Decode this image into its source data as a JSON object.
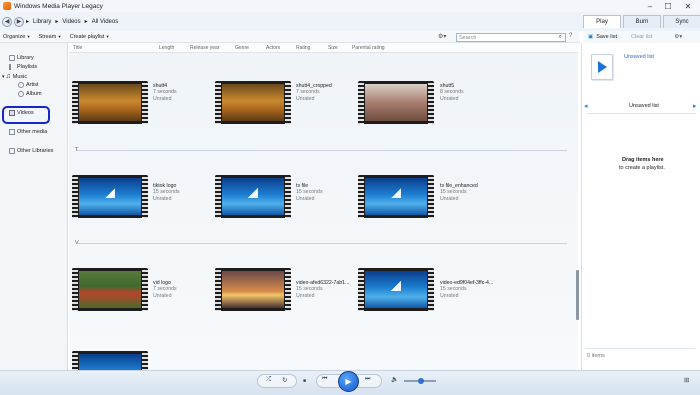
{
  "window": {
    "title": "Windows Media Player Legacy",
    "minimize": "–",
    "maximize": "☐",
    "close": "✕"
  },
  "nav": {
    "back_icon": "◀",
    "forward_icon": "▶",
    "breadcrumb": [
      "Library",
      "Videos",
      "All Videos"
    ],
    "sep": "▸"
  },
  "tabs": [
    {
      "label": "Play",
      "active": true
    },
    {
      "label": "Burn",
      "active": false
    },
    {
      "label": "Sync",
      "active": false
    }
  ],
  "toolbar": {
    "organize": "Organize",
    "stream": "Stream",
    "create_playlist": "Create playlist",
    "dropdown": "▾",
    "search_placeholder": "Search",
    "search_icon": "⌕"
  },
  "right_toolbar": {
    "save_list": "Save list",
    "clear_list": "Clear list"
  },
  "sidebar": {
    "items": [
      {
        "label": "Library"
      },
      {
        "label": "Playlists"
      },
      {
        "label": "Music"
      },
      {
        "label": "Artist"
      },
      {
        "label": "Album"
      },
      {
        "label": "Videos",
        "selected": true
      },
      {
        "label": "Other media"
      },
      {
        "label": "Other Libraries"
      }
    ]
  },
  "columns": [
    "Title",
    "Length",
    "Release year",
    "Genre",
    "Actors",
    "Rating",
    "Size",
    "Parental rating"
  ],
  "groups": [
    {
      "label": "",
      "items": [
        {
          "name": "shutt4",
          "duration": "7 seconds",
          "rating": "Unrated",
          "thumb": "golden"
        },
        {
          "name": "shutt4_cropped",
          "duration": "7 seconds",
          "rating": "Unrated",
          "thumb": "golden"
        },
        {
          "name": "shutt5",
          "duration": "8 seconds",
          "rating": "Unrated",
          "thumb": "room"
        }
      ]
    },
    {
      "label": "T",
      "items": [
        {
          "name": "tiktok logo",
          "duration": "15 seconds",
          "rating": "Unrated",
          "thumb": "ocean"
        },
        {
          "name": "ts file",
          "duration": "15 seconds",
          "rating": "Unrated",
          "thumb": "ocean"
        },
        {
          "name": "ts file_enhanced",
          "duration": "15 seconds",
          "rating": "Unrated",
          "thumb": "ocean"
        }
      ]
    },
    {
      "label": "V",
      "items": [
        {
          "name": "vid logo",
          "duration": "7 seconds",
          "rating": "Unrated",
          "thumb": "flowers"
        },
        {
          "name": "video-afed6322-7ab1...",
          "duration": "15 seconds",
          "rating": "Unrated",
          "thumb": "sunset"
        },
        {
          "name": "video-ed9f04ef-3ffc-4...",
          "duration": "15 seconds",
          "rating": "Unrated",
          "thumb": "ocean"
        }
      ]
    }
  ],
  "playlist": {
    "unsaved_title": "Unsaved list",
    "header": "Unsaved list",
    "drag_title": "Drag items here",
    "drag_sub": "to create a playlist.",
    "count": "0 items",
    "nav_left": "◂",
    "nav_right": "▸"
  },
  "player": {
    "shuffle": "⤮",
    "repeat": "↻",
    "stop": "■",
    "prev": "⏮",
    "play": "▶",
    "next": "⏭",
    "mute": "🔈",
    "switch": "⊞"
  }
}
